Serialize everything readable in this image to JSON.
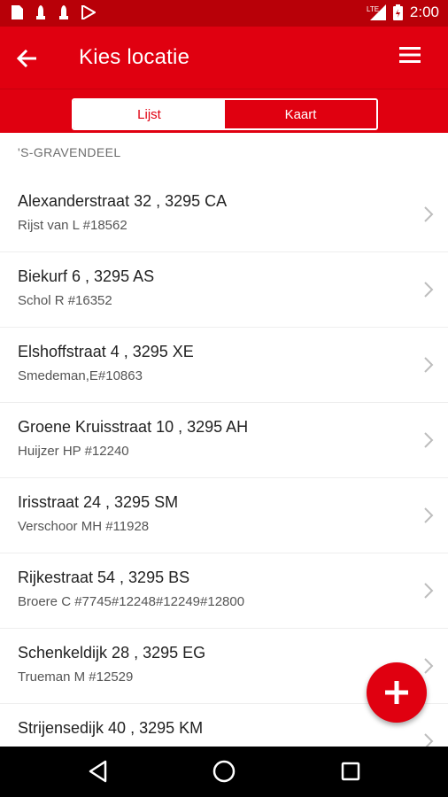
{
  "status_bar": {
    "time": "2:00",
    "network": "LTE",
    "left_icons": [
      "document-icon",
      "hand-icon",
      "hand-icon",
      "play-store-icon"
    ]
  },
  "app_bar": {
    "title": "Kies locatie"
  },
  "tabs": [
    {
      "label": "Lijst",
      "active": true
    },
    {
      "label": "Kaart",
      "active": false
    }
  ],
  "section_header": "'S-GRAVENDEEL",
  "locations": [
    {
      "address": "Alexanderstraat 32 , 3295 CA",
      "detail": "Rijst van L #18562"
    },
    {
      "address": "Biekurf 6 , 3295 AS",
      "detail": "Schol R #16352"
    },
    {
      "address": "Elshoffstraat 4 , 3295 XE",
      "detail": "Smedeman,E#10863"
    },
    {
      "address": "Groene Kruisstraat 10 , 3295 AH",
      "detail": "Huijzer HP #12240"
    },
    {
      "address": "Irisstraat 24 , 3295 SM",
      "detail": "Verschoor MH #11928"
    },
    {
      "address": "Rijkestraat 54 , 3295 BS",
      "detail": "Broere C #7745#12248#12249#12800"
    },
    {
      "address": "Schenkeldijk 28 , 3295 EG",
      "detail": "Trueman M #12529"
    },
    {
      "address": "Strijensedijk 40 , 3295 KM",
      "detail": ""
    }
  ],
  "colors": {
    "primary": "#e00010",
    "status_bar": "#b80008",
    "nav_bar": "#000000"
  }
}
